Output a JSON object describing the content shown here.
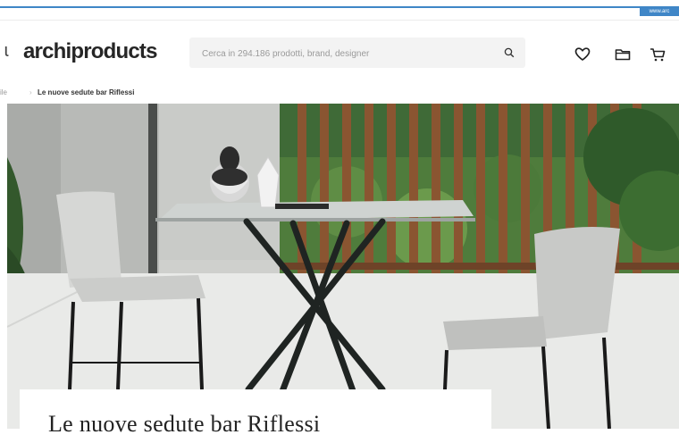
{
  "top_bar": {
    "tag_text": "www.arc"
  },
  "header": {
    "logo": "archiproducts",
    "search": {
      "placeholder": "Cerca in 294.186 prodotti, brand, designer"
    },
    "icons": [
      "heart-icon",
      "folder-icon",
      "cart-icon"
    ]
  },
  "breadcrumb": {
    "prev_fragment": "ile",
    "separator": "›",
    "current": "Le nuove sedute bar Riflessi"
  },
  "hero": {
    "caption_title": "Le nuove sedute bar Riflessi"
  },
  "colors": {
    "accent_blue": "#3f86c7",
    "search_bg": "#f3f3f3"
  }
}
